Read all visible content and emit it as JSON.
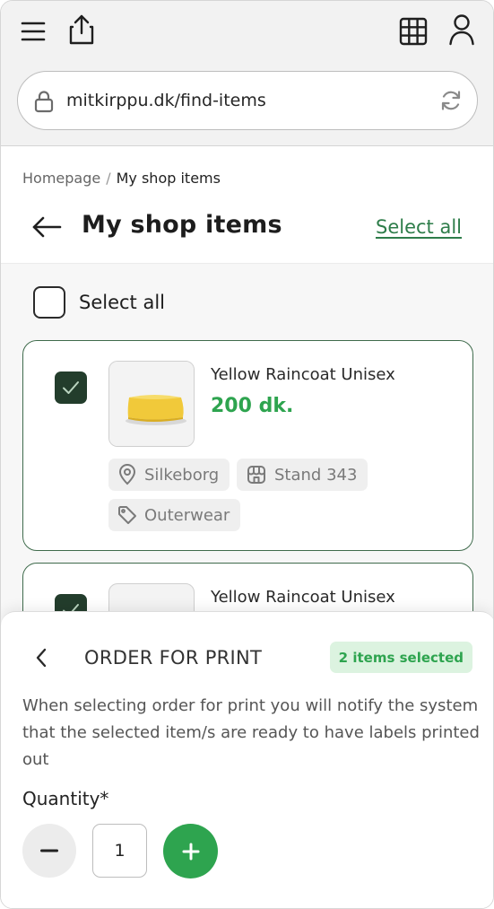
{
  "browser": {
    "url": "mitkirppu.dk/find-items",
    "icons": [
      "menu-icon",
      "share-icon",
      "grid-icon",
      "user-icon",
      "lock-icon",
      "reload-icon"
    ]
  },
  "breadcrumb": {
    "home": "Homepage",
    "separator": "/",
    "current": "My shop items"
  },
  "header": {
    "title": "My shop items",
    "select_all_link": "Select all"
  },
  "list": {
    "select_all_label": "Select all",
    "items": [
      {
        "name": "Yellow Raincoat Unisex",
        "price": "200 dk.",
        "location": "Silkeborg",
        "stand": "Stand 343",
        "category": "Outerwear",
        "checked": true
      },
      {
        "name": "Yellow Raincoat Unisex",
        "checked": true
      }
    ]
  },
  "sheet": {
    "title": "ORDER FOR PRINT",
    "badge": "2 items selected",
    "description": "When selecting order for print you will notify the system that the selected item/s are ready to have labels printed out",
    "quantity_label": "Quantity*",
    "quantity_value": "1"
  },
  "colors": {
    "accent_green": "#2ea44f",
    "dark_green": "#233d2c",
    "card_border": "#3f6b4c",
    "badge_bg": "#dcf3e0"
  }
}
